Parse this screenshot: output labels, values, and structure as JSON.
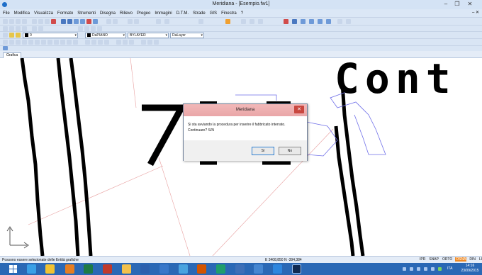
{
  "window": {
    "title": "Meridiana - [Esempio.fw1]",
    "controls": [
      "–",
      "❐",
      "✕"
    ]
  },
  "menu": {
    "items": [
      "File",
      "Modifica",
      "Visualizza",
      "Formato",
      "Strumenti",
      "Disegna",
      "Rilievo",
      "Pregeo",
      "Immagini",
      "D.T.M.",
      "Strade",
      "GIS",
      "Finestra",
      "?"
    ],
    "doc_controls": "– ✕"
  },
  "toolbar": {
    "layer_value": "0",
    "color_value": "DaPIANO",
    "linetype_value": "BYLAYER",
    "lineweight_value": "DaLayer"
  },
  "drawing_tab": "Grafica",
  "canvas": {
    "text_left": "7",
    "text_right": "Cont"
  },
  "dialog": {
    "title": "Meridiana",
    "message_line1": "Si sta avviando la procedura per inserire il fabbricato interrato.",
    "message_line2": "Continuare? S/N",
    "yes_label": "Sì",
    "no_label": "No"
  },
  "statusbar": {
    "hint": "Possono essere selezionate delle Entità grafiche",
    "coords": "E  3408,850  N  -394,384",
    "modes": [
      {
        "label": "IPR",
        "on": false
      },
      {
        "label": "SNAP",
        "on": false
      },
      {
        "label": "ORTO",
        "on": false
      },
      {
        "label": "OSNA",
        "on": true
      },
      {
        "label": "DIN",
        "on": false
      },
      {
        "label": "LI",
        "on": false
      }
    ]
  },
  "taskbar": {
    "time": "14:16",
    "date": "23/09/2015",
    "language": "ITA"
  },
  "colors": {
    "accent": "#2a68b5",
    "dialog_title": "#eeaeb0",
    "snap_on": "#f08a24",
    "grid_red": "#e8a0a0",
    "polyline_blue": "#6f6fe8"
  }
}
